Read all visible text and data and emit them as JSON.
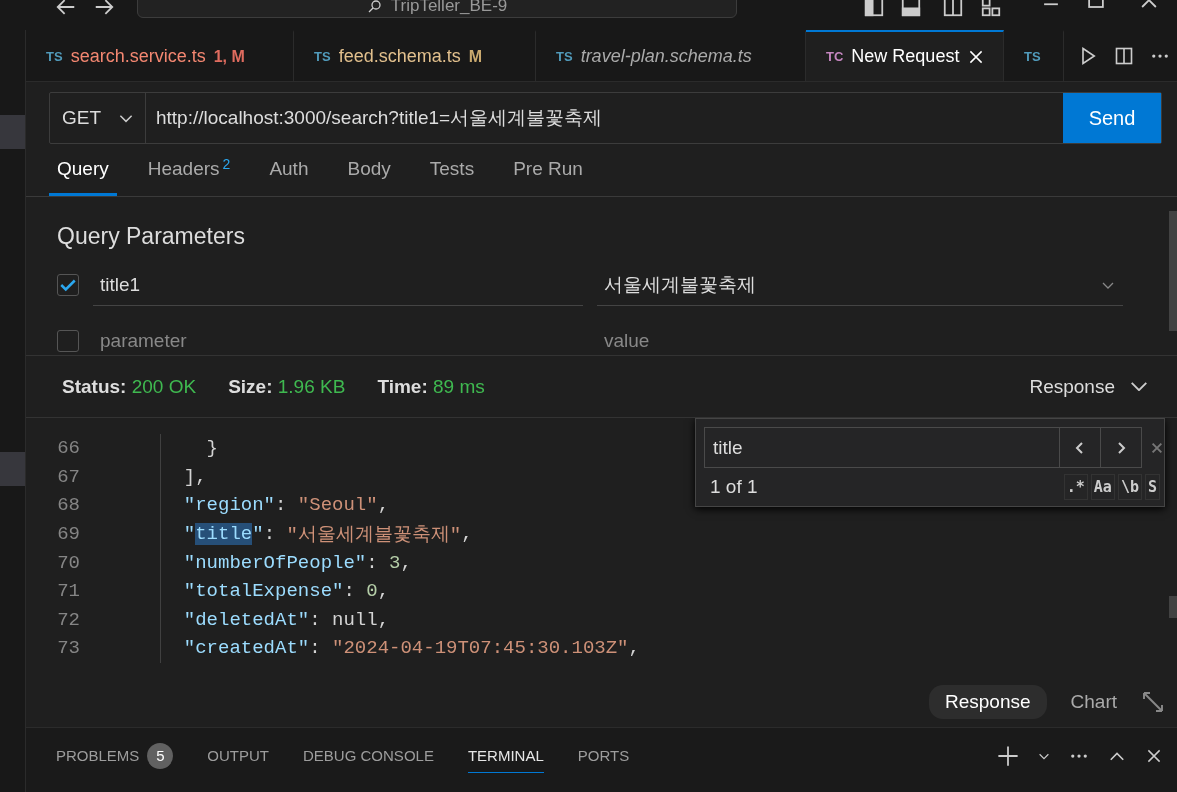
{
  "title_bar": {
    "search": "TripTeller_BE-9"
  },
  "editor_tabs": [
    {
      "icon": "TS",
      "label": "search.service.ts",
      "badge": "1, M",
      "kind": "error",
      "selected": false
    },
    {
      "icon": "TS",
      "label": "feed.schema.ts",
      "badge": "M",
      "kind": "modified",
      "selected": false
    },
    {
      "icon": "TS",
      "label": "travel-plan.schema.ts",
      "kind": "preview",
      "selected": false
    },
    {
      "icon": "TC",
      "label": "New Request",
      "kind": "plain",
      "selected": true
    },
    {
      "icon": "TS",
      "kind": "overflow",
      "selected": false
    }
  ],
  "request": {
    "method": "GET",
    "url": "http://localhost:3000/search?title1=서울세계불꽃축제",
    "send": "Send"
  },
  "request_tabs": [
    {
      "label": "Query",
      "selected": true
    },
    {
      "label": "Headers",
      "count": "2",
      "selected": false
    },
    {
      "label": "Auth",
      "selected": false
    },
    {
      "label": "Body",
      "selected": false
    },
    {
      "label": "Tests",
      "selected": false
    },
    {
      "label": "Pre Run",
      "selected": false
    }
  ],
  "query_parameters": {
    "title": "Query Parameters",
    "rows": [
      {
        "checked": true,
        "name": "title1",
        "value": "서울세계불꽃축제"
      },
      {
        "checked": false,
        "name_placeholder": "parameter",
        "value_placeholder": "value"
      }
    ]
  },
  "status": {
    "items": [
      {
        "label": "Status:",
        "value": "200 OK"
      },
      {
        "label": "Size:",
        "value": "1.96 KB"
      },
      {
        "label": "Time:",
        "value": "89 ms"
      }
    ],
    "view": "Response"
  },
  "code": {
    "lines": [
      {
        "number": "66",
        "tokens": [
          {
            "kind": "punct",
            "text": "    }"
          }
        ]
      },
      {
        "number": "67",
        "tokens": [
          {
            "kind": "punct",
            "text": "  ],"
          }
        ]
      },
      {
        "number": "68",
        "tokens": [
          {
            "kind": "key",
            "text": "  \"region\""
          },
          {
            "kind": "punct",
            "text": ": "
          },
          {
            "kind": "string",
            "text": "\"Seoul\""
          },
          {
            "kind": "punct",
            "text": ","
          }
        ]
      },
      {
        "number": "69",
        "tokens": [
          {
            "kind": "key",
            "text": "  \""
          },
          {
            "kind": "match",
            "text": "title"
          },
          {
            "kind": "key",
            "text": "\""
          },
          {
            "kind": "punct",
            "text": ": "
          },
          {
            "kind": "string",
            "text": "\"서울세계불꽃축제\""
          },
          {
            "kind": "punct",
            "text": ","
          }
        ]
      },
      {
        "number": "70",
        "tokens": [
          {
            "kind": "key",
            "text": "  \"numberOfPeople\""
          },
          {
            "kind": "punct",
            "text": ": "
          },
          {
            "kind": "number",
            "text": "3"
          },
          {
            "kind": "punct",
            "text": ","
          }
        ]
      },
      {
        "number": "71",
        "tokens": [
          {
            "kind": "key",
            "text": "  \"totalExpense\""
          },
          {
            "kind": "punct",
            "text": ": "
          },
          {
            "kind": "number",
            "text": "0"
          },
          {
            "kind": "punct",
            "text": ","
          }
        ]
      },
      {
        "number": "72",
        "tokens": [
          {
            "kind": "key",
            "text": "  \"deletedAt\""
          },
          {
            "kind": "punct",
            "text": ": "
          },
          {
            "kind": "null",
            "text": "null"
          },
          {
            "kind": "punct",
            "text": ","
          }
        ]
      },
      {
        "number": "73",
        "tokens": [
          {
            "kind": "key",
            "text": "  \"createdAt\""
          },
          {
            "kind": "punct",
            "text": ": "
          },
          {
            "kind": "string",
            "text": "\"2024-04-19T07:45:30.103Z\""
          },
          {
            "kind": "punct",
            "text": ","
          }
        ]
      }
    ]
  },
  "find": {
    "query": "title",
    "result": "1 of 1",
    "options": [
      ".*",
      "Aa",
      "\\b",
      "S"
    ]
  },
  "response_tabs": [
    {
      "label": "Response",
      "selected": true
    },
    {
      "label": "Chart",
      "selected": false
    }
  ],
  "panel_tabs": [
    {
      "label": "PROBLEMS",
      "count": "5",
      "selected": false
    },
    {
      "label": "OUTPUT",
      "selected": false
    },
    {
      "label": "DEBUG CONSOLE",
      "selected": false
    },
    {
      "label": "TERMINAL",
      "selected": true
    },
    {
      "label": "PORTS",
      "selected": false
    }
  ]
}
